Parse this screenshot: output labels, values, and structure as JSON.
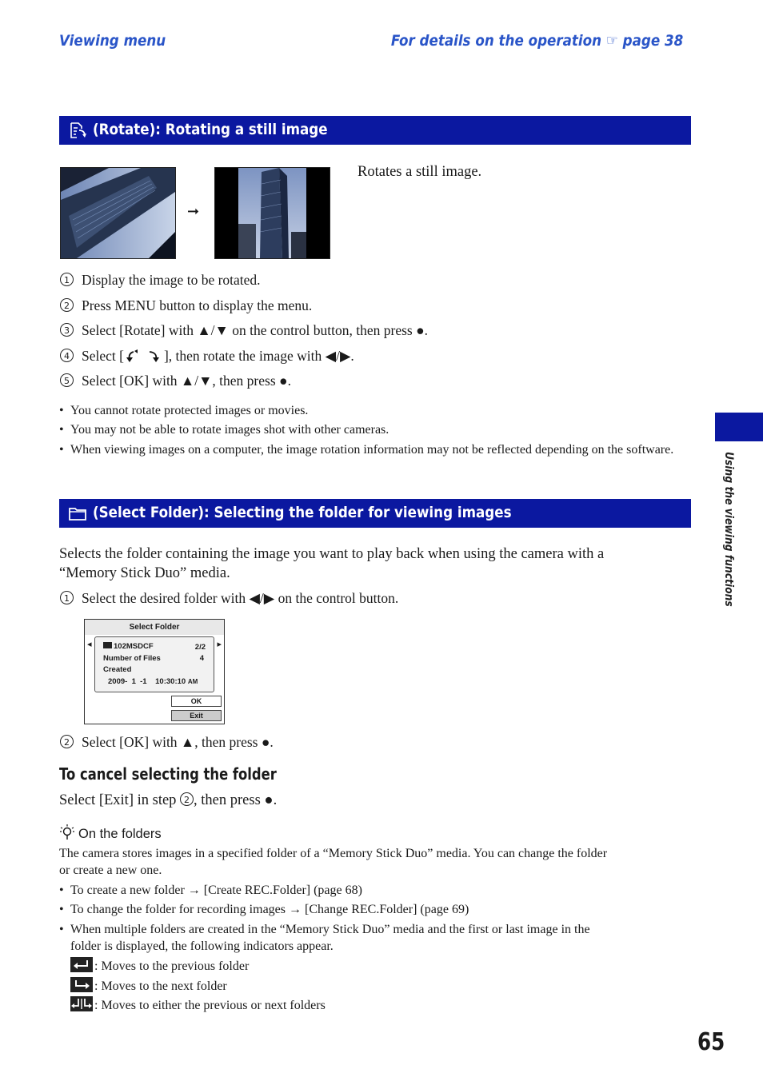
{
  "header": {
    "left": "Viewing menu",
    "right": "For details on the operation ☞ page 38"
  },
  "rotate_section": {
    "icon": "rotate-icon",
    "title": "(Rotate): Rotating a still image",
    "arrow": "➞",
    "description": "Rotates a still image.",
    "steps": [
      {
        "num": "1",
        "text": "Display the image to be rotated."
      },
      {
        "num": "2",
        "text": "Press MENU button to display the menu."
      },
      {
        "num": "3",
        "text": "Select [Rotate] with ▲/▼ on the control button, then press ●."
      },
      {
        "num": "4",
        "text_before": "Select [",
        "text_after": "], then rotate the image with ◀/▶."
      },
      {
        "num": "5",
        "text": "Select [OK] with ▲/▼, then press ●."
      }
    ],
    "notes": [
      "You cannot rotate protected images or movies.",
      "You may not be able to rotate images shot with other cameras.",
      "When viewing images on a computer, the image rotation information may not be reflected depending on the software."
    ]
  },
  "folder_section": {
    "icon": "folder-icon",
    "title": "(Select Folder): Selecting the folder for viewing images",
    "intro": [
      "Selects the folder containing the image you want to play back when using the camera with a",
      "“Memory Stick Duo” media."
    ],
    "step1": {
      "num": "1",
      "text": "Select the desired folder with ◀/▶ on the control button."
    },
    "screen": {
      "title": "Select Folder",
      "folder_name": "102MSDCF",
      "folder_index": "2/2",
      "files_label": "Number of Files",
      "files_value": "4",
      "created_label": "Created",
      "created_value": "2009-  1  -1    10:30:10",
      "created_ampm": "AM",
      "ok_label": "OK",
      "exit_label": "Exit"
    },
    "step2": {
      "num": "2",
      "text": "Select [OK] with ▲, then press ●."
    },
    "cancel": {
      "heading": "To cancel selecting the folder",
      "text_before": "Select [Exit] in step ",
      "step_ref": "2",
      "text_after": ", then press ●."
    },
    "tip": {
      "icon": "lightbulb-icon",
      "heading": "On the folders",
      "para": [
        "The camera stores images in a specified folder of a “Memory Stick Duo” media. You can change the folder",
        "or create a new one."
      ],
      "bullets": [
        {
          "text": "To create a new folder → [Create REC.Folder] (page 68)"
        },
        {
          "text": "To change the folder for recording images → [Change REC.Folder] (page 69)"
        },
        {
          "text": "When multiple folders are created in the “Memory Stick Duo” media and the first or last image in the",
          "text2": "folder is displayed, the following indicators appear."
        }
      ],
      "indicators": [
        {
          "icon": "previous-folder-icon",
          "text": ": Moves to the previous folder"
        },
        {
          "icon": "next-folder-icon",
          "text": ": Moves to the next folder"
        },
        {
          "icon": "previous-or-next-folder-icon",
          "text": ": Moves to either the previous or next folders"
        }
      ]
    }
  },
  "side_tab": {
    "label": "Using the viewing functions"
  },
  "page_number": "65"
}
